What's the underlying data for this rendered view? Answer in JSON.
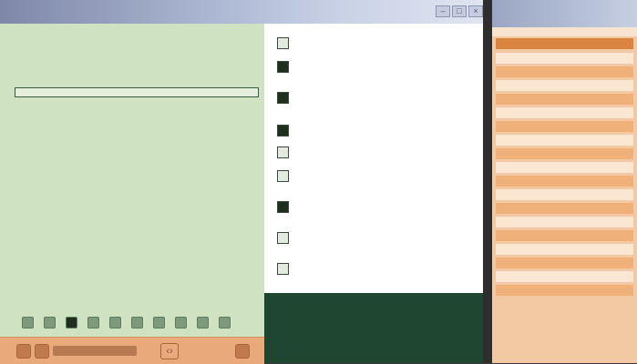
{
  "window": {
    "title": "",
    "buttons": [
      "–",
      "□",
      "×"
    ]
  },
  "reading": {
    "title": "",
    "subtitle": "",
    "search_placeholder": "",
    "body": "",
    "page_count": 10,
    "active_page": 3,
    "footer": {
      "label": "",
      "arrow": "‹›"
    }
  },
  "checklist": {
    "items": [
      {
        "text": "",
        "checked": false
      },
      {
        "text": "",
        "checked": true
      },
      {
        "text": "",
        "checked": true
      },
      {
        "text": "",
        "checked": true
      },
      {
        "text": "",
        "checked": false
      },
      {
        "text": "",
        "checked": false
      },
      {
        "text": "",
        "checked": true
      },
      {
        "text": "",
        "checked": false
      },
      {
        "text": "",
        "checked": false
      }
    ]
  },
  "notice": {
    "text": ""
  },
  "calendar": {
    "title": "",
    "header": "",
    "rows": [
      {
        "style": "light"
      },
      {
        "style": "orange"
      },
      {
        "style": "light"
      },
      {
        "style": "orange"
      },
      {
        "style": "light"
      },
      {
        "style": "orange"
      },
      {
        "style": "light"
      },
      {
        "style": "orange"
      },
      {
        "style": "light"
      },
      {
        "style": "orange"
      },
      {
        "style": "light"
      },
      {
        "style": "orange"
      },
      {
        "style": "light"
      },
      {
        "style": "orange"
      },
      {
        "style": "light"
      },
      {
        "style": "orange"
      },
      {
        "style": "light"
      },
      {
        "style": "orange"
      }
    ],
    "note": ""
  },
  "colors": {
    "reading_bg": "#cfe2c2",
    "footer_bg": "#e9a97b",
    "notice_bg": "#1f4630",
    "calendar_bg": "#f2c9a3",
    "calendar_row_orange": "#f0b07a",
    "calendar_row_light": "#fbe6d2"
  }
}
